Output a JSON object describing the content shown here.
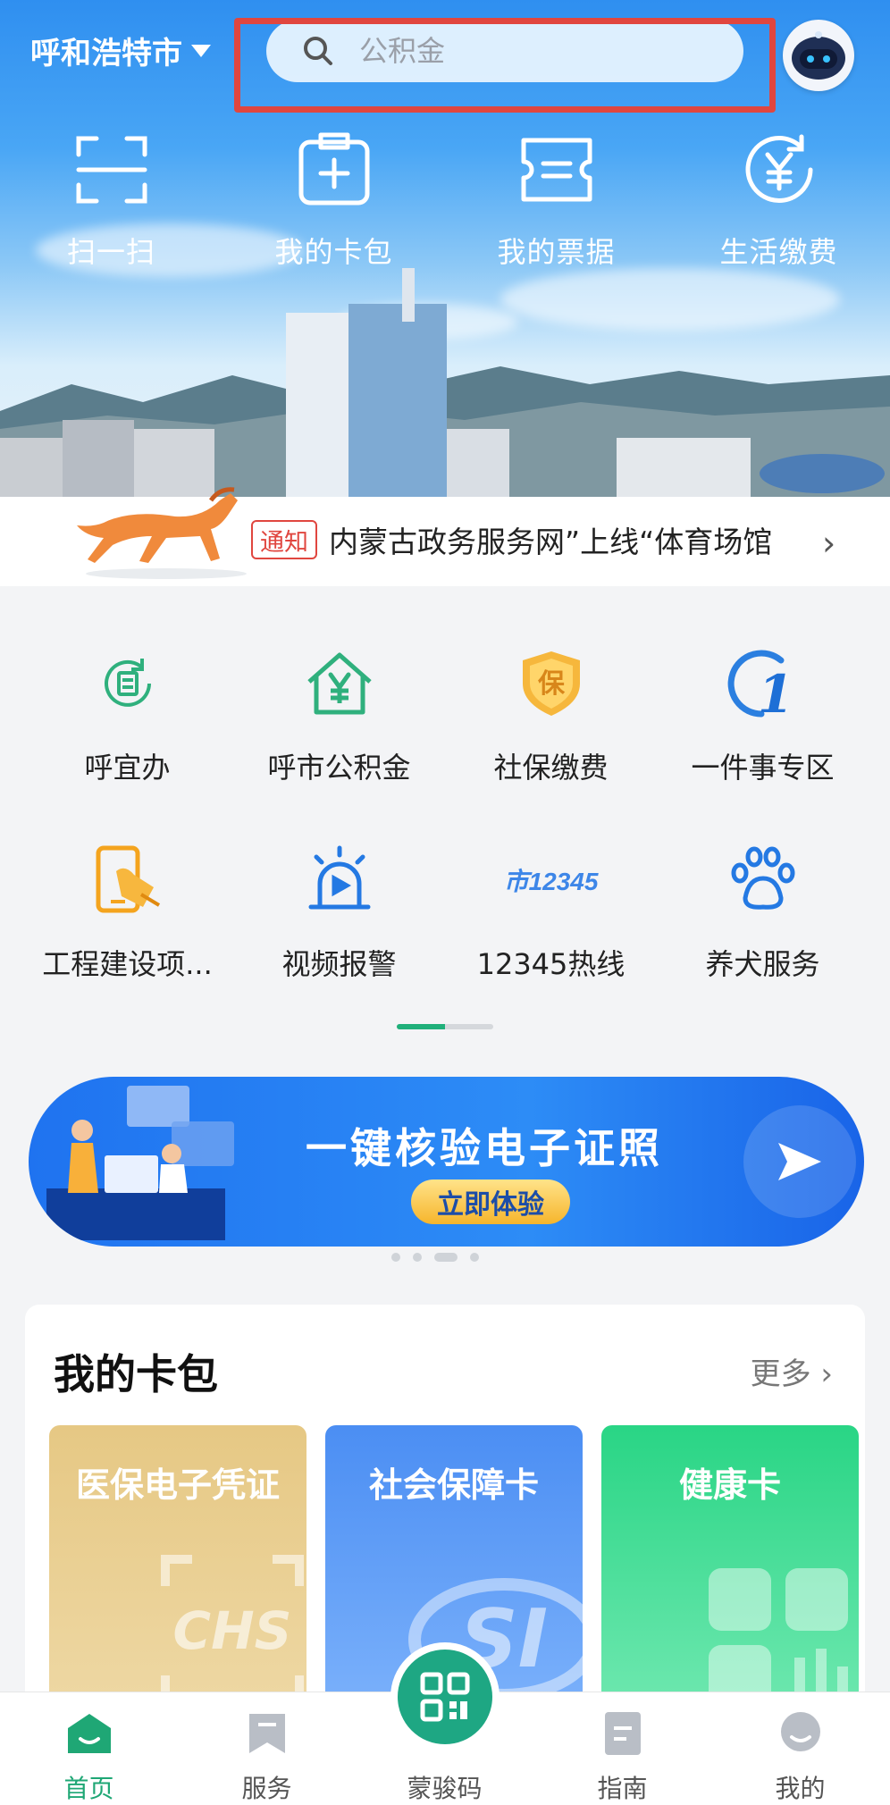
{
  "header": {
    "city": "呼和浩特市",
    "search_placeholder": "公积金"
  },
  "quick_actions": [
    {
      "label": "扫一扫",
      "icon": "scan-icon"
    },
    {
      "label": "我的卡包",
      "icon": "card-wallet-icon"
    },
    {
      "label": "我的票据",
      "icon": "ticket-icon"
    },
    {
      "label": "生活缴费",
      "icon": "yuan-payment-icon"
    }
  ],
  "notice": {
    "tag": "通知",
    "text": "内蒙古政务服务网”上线“体育场馆"
  },
  "services": [
    {
      "label": "呼宜办",
      "icon": "huyiban-icon"
    },
    {
      "label": "呼市公积金",
      "icon": "housing-fund-icon"
    },
    {
      "label": "社保缴费",
      "icon": "social-security-icon"
    },
    {
      "label": "一件事专区",
      "icon": "one-thing-icon"
    },
    {
      "label": "工程建设项...",
      "icon": "construction-icon"
    },
    {
      "label": "视频报警",
      "icon": "alarm-icon"
    },
    {
      "label": "12345热线",
      "icon": "hotline-icon"
    },
    {
      "label": "养犬服务",
      "icon": "paw-icon"
    }
  ],
  "hotline_icon_text": "市12345",
  "banner": {
    "title": "一键核验电子证照",
    "button": "立即体验"
  },
  "card_pack": {
    "title": "我的卡包",
    "more": "更多",
    "cards": [
      {
        "label": "医保电子凭证",
        "watermark": "CHS"
      },
      {
        "label": "社会保障卡",
        "watermark": "SI"
      },
      {
        "label": "健康卡"
      }
    ]
  },
  "tabbar": [
    {
      "label": "首页",
      "icon": "home-icon",
      "active": true
    },
    {
      "label": "服务",
      "icon": "bookmark-icon"
    },
    {
      "label": "蒙骏码",
      "icon": "qr-code-icon"
    },
    {
      "label": "指南",
      "icon": "guide-icon"
    },
    {
      "label": "我的",
      "icon": "profile-icon"
    }
  ],
  "colors": {
    "accent": "#1fa775",
    "highlight": "#e0463f",
    "banner": "#1f73f0"
  }
}
